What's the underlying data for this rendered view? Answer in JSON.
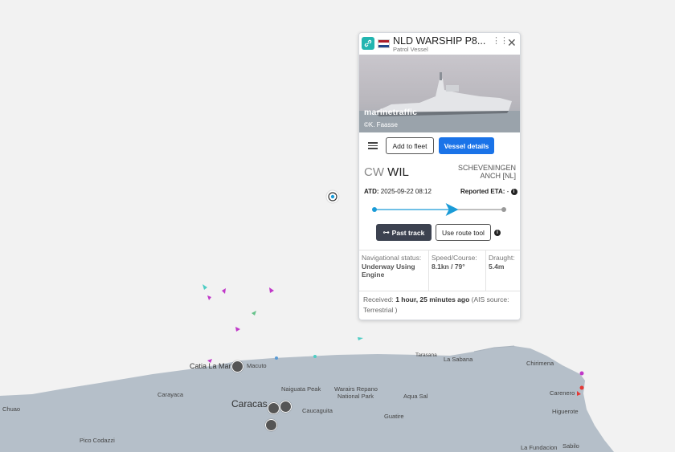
{
  "vessel": {
    "name": "NLD WARSHIP P8...",
    "type": "Patrol Vessel",
    "photo_watermark": "marinetraffic",
    "photo_credit": "©K. Faasse",
    "add_fleet_label": "Add to fleet",
    "details_label": "Vessel details",
    "origin_prefix": "CW",
    "origin_port": "WIL",
    "destination": "SCHEVENINGEN ANCH [NL]",
    "atd_label": "ATD:",
    "atd_value": "2025-09-22 08:12",
    "eta_label": "Reported ETA:",
    "eta_value": "-",
    "past_track_label": "Past track",
    "route_tool_label": "Use route tool",
    "nav_status_label": "Navigational status:",
    "nav_status_value": "Underway Using Engine",
    "speed_label": "Speed/Course:",
    "speed_value": "8.1kn / 79°",
    "draught_label": "Draught:",
    "draught_value": "5.4m",
    "received_prefix": "Received:",
    "received_time": "1 hour, 25 minutes ago",
    "received_source": "(AIS source: Terrestrial )",
    "track_progress": 0.6
  },
  "colors": {
    "accent_blue": "#1a73e8",
    "teal": "#22b5b0",
    "land": "#b5bfc9",
    "sea": "#f2f2f2",
    "track": "#1a9bd7"
  },
  "map": {
    "places": [
      "Catia La Mar",
      "Macuto",
      "Tarasana",
      "La Sabana",
      "Chirimena",
      "Carenero",
      "Higuerote",
      "Carayaca",
      "Naiguata Peak",
      "Warairs Repano",
      "National Park",
      "Caracas",
      "Caucaguita",
      "Aqua Sal",
      "Guatire",
      "Chuao",
      "Pico Codazzi",
      "La Fundacion",
      "Sabilo"
    ]
  }
}
